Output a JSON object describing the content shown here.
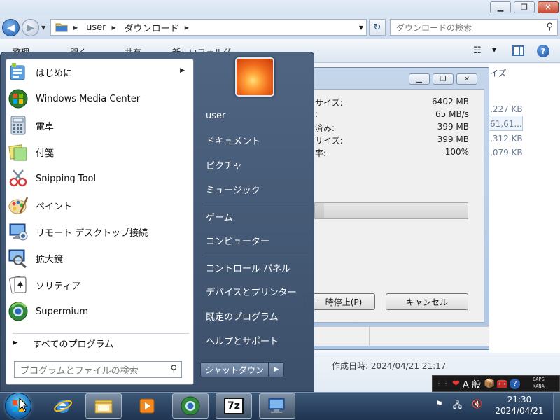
{
  "explorer": {
    "breadcrumbs": [
      "user",
      "ダウンロード"
    ],
    "search_placeholder": "ダウンロードの検索",
    "toolbar": [
      "整理",
      "開く",
      "共有",
      "新しいフォルダー"
    ],
    "size_header": "イズ",
    "file_sizes": [
      ",227 KB",
      "61,61...",
      ",312 KB",
      ",079 KB"
    ],
    "created_label": "作成日時: 2024/04/21 21:17"
  },
  "progress_dialog": {
    "stats": [
      {
        "label": "サイズ:",
        "value": "6402 MB"
      },
      {
        "label": ":",
        "value": "65 MB/s"
      },
      {
        "label": "済み:",
        "value": "399 MB"
      },
      {
        "label": "サイズ:",
        "value": "399 MB"
      },
      {
        "label": "率:",
        "value": "100%"
      }
    ],
    "progress_fraction": 0.06,
    "pause_button": "一時停止(P)",
    "cancel_button": "キャンセル"
  },
  "start_menu": {
    "programs": [
      {
        "label": "はじめに",
        "icon": "getting-started-icon",
        "has_submenu": true
      },
      {
        "label": "Windows Media Center",
        "icon": "media-center-icon",
        "has_submenu": false
      },
      {
        "label": "電卓",
        "icon": "calculator-icon",
        "has_submenu": false
      },
      {
        "label": "付箋",
        "icon": "sticky-notes-icon",
        "has_submenu": false
      },
      {
        "label": "Snipping Tool",
        "icon": "snipping-tool-icon",
        "has_submenu": false
      },
      {
        "label": "ペイント",
        "icon": "paint-icon",
        "has_submenu": false
      },
      {
        "label": "リモート デスクトップ接続",
        "icon": "remote-desktop-icon",
        "has_submenu": false
      },
      {
        "label": "拡大鏡",
        "icon": "magnifier-icon",
        "has_submenu": false
      },
      {
        "label": "ソリティア",
        "icon": "solitaire-icon",
        "has_submenu": false
      },
      {
        "label": "Supermium",
        "icon": "supermium-icon",
        "has_submenu": false
      }
    ],
    "all_programs": "すべてのプログラム",
    "search_placeholder": "プログラムとファイルの検索",
    "right_items": [
      "user",
      "ドキュメント",
      "ピクチャ",
      "ミュージック",
      "ゲーム",
      "コンピューター",
      "コントロール パネル",
      "デバイスとプリンター",
      "既定のプログラム",
      "ヘルプとサポート"
    ],
    "shutdown": "シャットダウン"
  },
  "ime": {
    "mode": "A 般",
    "caps": "CAPS",
    "kana": "KANA"
  },
  "taskbar": {
    "apps": [
      "internet-explorer-icon",
      "explorer-icon",
      "media-player-icon",
      "supermium-icon",
      "7zip-icon",
      "remote-desktop-icon"
    ],
    "sevenzip_label": "7z",
    "time": "21:30",
    "date": "2024/04/21"
  },
  "colors": {
    "taskbar": "#1e3450",
    "startmenu": "#4a607d",
    "accent": "#1c7bc4"
  }
}
